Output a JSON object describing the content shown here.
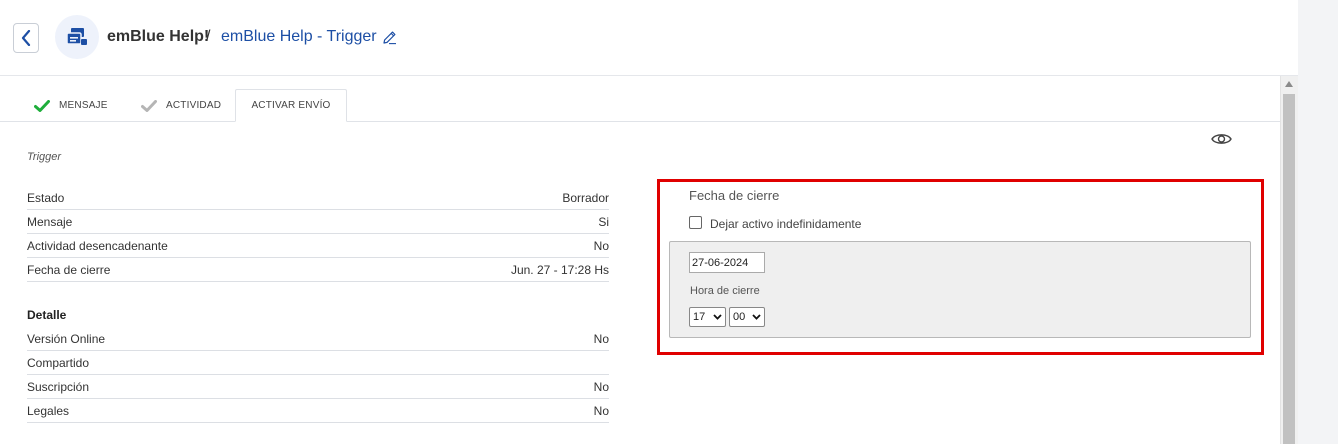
{
  "header": {
    "campaign_name": "emBlue Help!",
    "separator": "/",
    "action_name": "emBlue Help - Trigger"
  },
  "tabs": [
    {
      "label": "MENSAJE",
      "status": "complete",
      "check_color": "#1fae3b"
    },
    {
      "label": "ACTIVIDAD",
      "status": "pending",
      "check_color": "#b5b5b5"
    },
    {
      "label": "ACTIVAR ENVÍO",
      "status": "active"
    }
  ],
  "summary": {
    "title": "Trigger",
    "rows": [
      {
        "label": "Estado",
        "value": "Borrador"
      },
      {
        "label": "Mensaje",
        "value": "Si"
      },
      {
        "label": "Actividad desencadenante",
        "value": "No"
      },
      {
        "label": "Fecha de cierre",
        "value": "Jun. 27 - 17:28 Hs"
      }
    ]
  },
  "detail": {
    "title": "Detalle",
    "rows": [
      {
        "label": "Versión Online",
        "value": "No"
      },
      {
        "label": "Compartido",
        "value": ""
      },
      {
        "label": "Suscripción",
        "value": "No"
      },
      {
        "label": "Legales",
        "value": "No"
      }
    ]
  },
  "closing": {
    "title": "Fecha de cierre",
    "checkbox_label": "Dejar activo indefinidamente",
    "checkbox_checked": false,
    "date_value": "27-06-2024",
    "hour_label": "Hora de cierre",
    "hour_value": "17",
    "minute_value": "00",
    "highlight_color": "#e00000"
  },
  "colors": {
    "accent": "#1d4fa5",
    "check_green": "#1fae3b"
  }
}
